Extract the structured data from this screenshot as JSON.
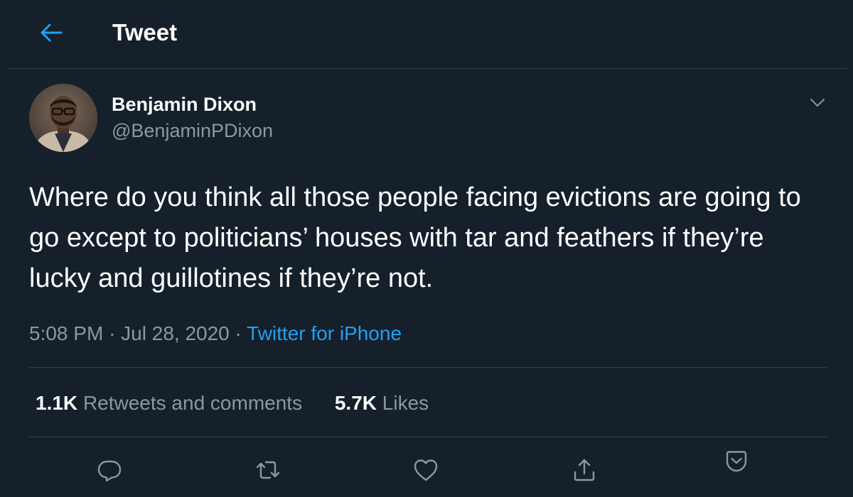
{
  "header": {
    "title": "Tweet",
    "back_icon": "arrow-left-icon"
  },
  "author": {
    "name": "Benjamin Dixon",
    "handle": "@BenjaminPDixon"
  },
  "tweet": {
    "text": "Where do you think all those people facing evictions are going to go except to politicians’ houses with tar and feathers if they’re lucky and guillotines if they’re not."
  },
  "meta": {
    "time": "5:08 PM",
    "separator": "·",
    "date": "Jul 28, 2020",
    "source": "Twitter for iPhone"
  },
  "stats": {
    "retweets_count": "1.1K",
    "retweets_label": "Retweets and comments",
    "likes_count": "5.7K",
    "likes_label": "Likes"
  },
  "actions": {
    "icons": [
      "reply-icon",
      "retweet-icon",
      "like-icon",
      "share-icon",
      "save-icon"
    ]
  },
  "colors": {
    "background": "#15202b",
    "accent": "#1da1f2",
    "secondary_text": "#8899a6",
    "divider": "#38444d"
  }
}
